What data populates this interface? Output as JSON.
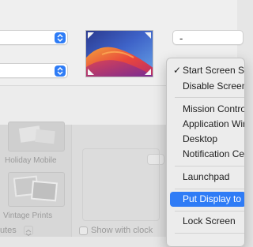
{
  "top": {
    "right_popup_value": "-"
  },
  "background": {
    "wallpapers": [
      {
        "label": "Holiday Mobile"
      },
      {
        "label": "Vintage Prints"
      }
    ],
    "bottom_left_label": "utes",
    "show_with_clock_label": "Show with clock"
  },
  "menu": {
    "items": [
      {
        "label": "Start Screen Saver",
        "checked": true
      },
      {
        "label": "Disable Screen Saver",
        "checked": false
      },
      {
        "label": "Mission Control",
        "checked": false
      },
      {
        "label": "Application Windows",
        "checked": false
      },
      {
        "label": "Desktop",
        "checked": false
      },
      {
        "label": "Notification Center",
        "checked": false
      },
      {
        "label": "Launchpad",
        "checked": false
      },
      {
        "label": "Put Display to Sleep",
        "checked": false,
        "highlighted": true
      },
      {
        "label": "Lock Screen",
        "checked": false
      }
    ],
    "check_glyph": "✓"
  },
  "colors": {
    "accent": "#2f7cf6"
  }
}
